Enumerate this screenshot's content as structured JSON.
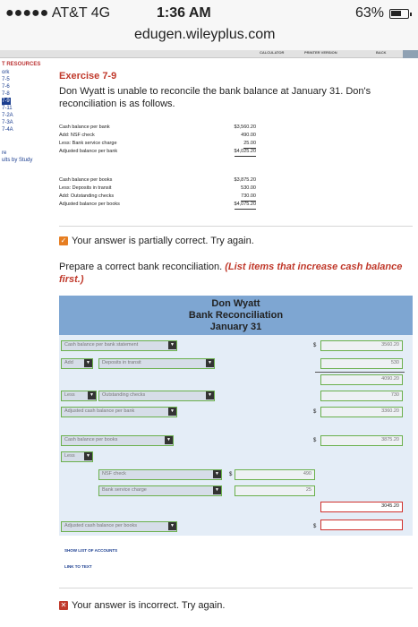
{
  "status": {
    "carrier": "●●●●● AT&T  4G",
    "time": "1:36 AM",
    "battery": "63%",
    "battery_level": 0.63
  },
  "browser": {
    "url": "edugen.wileyplus.com"
  },
  "toolbar": {
    "items": [
      "CALCULATOR",
      "PRINTER VERSION",
      "BACK"
    ]
  },
  "sidebar": {
    "title": "T RESOURCES",
    "items": [
      "ork",
      "7-5",
      "7-6",
      "7-8",
      "7-9",
      "7-11",
      "7-2A",
      "7-3A",
      "7-4A",
      "re",
      "ults by Study"
    ]
  },
  "exercise": {
    "title": "Exercise 7-9",
    "text": "Don Wyatt is unable to reconcile the bank balance at January 31. Don's reconciliation is as follows."
  },
  "bank_recon": {
    "rows": [
      {
        "label": "Cash balance per bank",
        "value": "$3,560.20"
      },
      {
        "label": "Add: NSF check",
        "value": "490.00"
      },
      {
        "label": "Less: Bank service charge",
        "value": "25.00"
      },
      {
        "label": "Adjusted balance per bank",
        "value": "$4,025.20"
      }
    ]
  },
  "book_recon": {
    "rows": [
      {
        "label": "Cash balance per books",
        "value": "$3,875.20"
      },
      {
        "label": "Less: Deposits in transit",
        "value": "530.00"
      },
      {
        "label": "Add: Outstanding checks",
        "value": "730.00"
      },
      {
        "label": "Adjusted balance per books",
        "value": "$4,075.20"
      }
    ]
  },
  "feedback1": {
    "text": "Your answer is partially correct.  Try again."
  },
  "prepare": {
    "text": "Prepare a correct bank reconciliation. ",
    "emphasis": "(List items that increase cash balance first.)"
  },
  "statement": {
    "name": "Don Wyatt",
    "title": "Bank Reconciliation",
    "date": "January 31"
  },
  "form": {
    "cash_per_bank": "Cash balance per bank statement",
    "cash_per_bank_amount": "3560.20",
    "add1": "Add",
    "deposits": "Deposits in transit",
    "deposits_amount": "530",
    "subtotal1": "4090.20",
    "less1": "Less",
    "outstanding": "Outstanding checks",
    "outstanding_amount": "730",
    "adj_bank": "Adjusted cash balance per bank",
    "adj_bank_amount": "3360.20",
    "cash_per_books": "Cash balance per books",
    "cash_per_books_amount": "3875.20",
    "less2": "Less",
    "nsf": "NSF check",
    "nsf_amount": "490",
    "service": "Bank service charge",
    "service_amount": "25",
    "subtotal2": "3045.20",
    "adj_books": "Adjusted cash balance per books",
    "adj_books_amount": "",
    "dollar": "$"
  },
  "links": {
    "accounts": "SHOW LIST OF ACCOUNTS",
    "text": "LINK TO TEXT"
  },
  "feedback2": {
    "text": "Your answer is incorrect.  Try again."
  },
  "colors": {
    "accent_red": "#c0392b",
    "header_blue": "#7ea6d2",
    "body_blue": "#e4edf7",
    "ok_green": "#6ab04c",
    "error_red": "#d0312d"
  }
}
